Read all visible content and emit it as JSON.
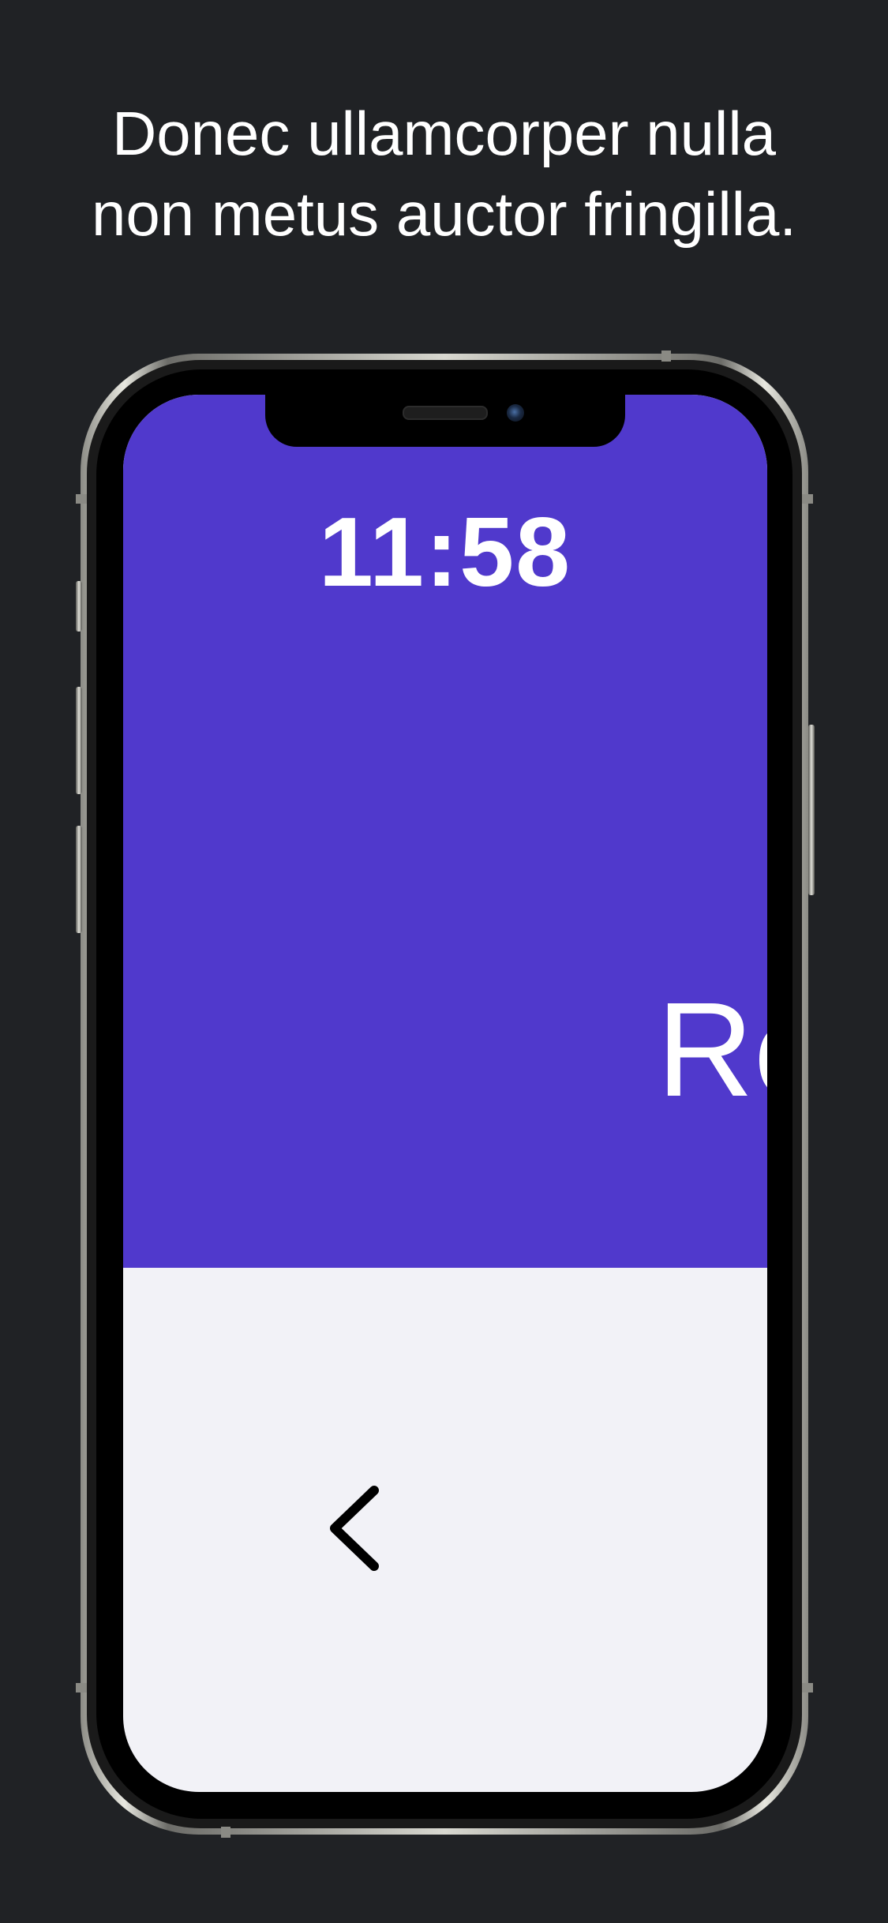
{
  "headline": {
    "line1": "Donec ullamcorper nulla",
    "line2": "non metus auctor fringilla."
  },
  "status_bar": {
    "time": "11:58"
  },
  "screen": {
    "hero_text": "Re",
    "back_icon": "chevron-left-icon"
  },
  "colors": {
    "background": "#202225",
    "accent": "#5039cc",
    "screen_background": "#f2f2f7",
    "text_on_accent": "#ffffff"
  }
}
